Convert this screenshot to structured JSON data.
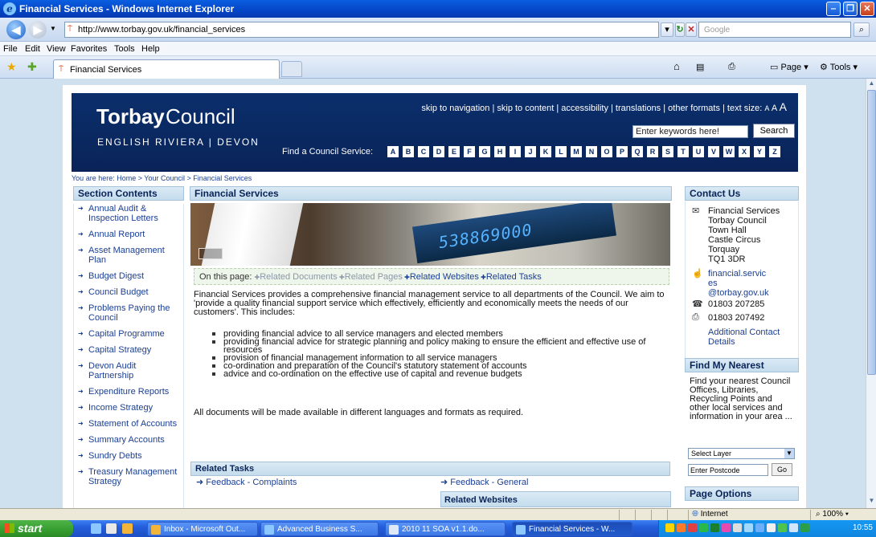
{
  "window": {
    "title": "Financial Services - Windows Internet Explorer",
    "minimize": "‒",
    "restore": "❐",
    "close": "✕"
  },
  "addressbar": {
    "url": "http://www.torbay.gov.uk/financial_services",
    "search_placeholder": "Google"
  },
  "menu": [
    "File",
    "Edit",
    "View",
    "Favorites",
    "Tools",
    "Help"
  ],
  "tab": {
    "label": "Financial Services"
  },
  "commandbar": {
    "page": "Page",
    "tools": "Tools"
  },
  "site": {
    "logo_main": "Torbay",
    "logo_sub": "Council",
    "tagline": "ENGLISH RIVIERA | DEVON",
    "toplinks": "skip to navigation | skip to content | accessibility | translations | other formats | text size:",
    "textsize_small": "A",
    "textsize_medium": "A",
    "textsize_large": "A",
    "search_value": "Enter keywords here!",
    "search_button": "Search",
    "find_service": "Find a Council Service:",
    "az": [
      "A",
      "B",
      "C",
      "D",
      "E",
      "F",
      "G",
      "H",
      "I",
      "J",
      "K",
      "L",
      "M",
      "N",
      "O",
      "P",
      "Q",
      "R",
      "S",
      "T",
      "U",
      "V",
      "W",
      "X",
      "Y",
      "Z"
    ],
    "breadcrumb": "You are here: Home > Your Council > Financial Services"
  },
  "section_contents": {
    "heading": "Section Contents",
    "items": [
      "Annual Audit & Inspection Letters",
      "Annual Report",
      "Asset Management Plan",
      "Budget Digest",
      "Council Budget",
      "Problems Paying the Council",
      "Capital Programme",
      "Capital Strategy",
      "Devon Audit Partnership",
      "Expenditure Reports",
      "Income Strategy",
      "Statement of Accounts",
      "Summary Accounts",
      "Sundry Debts",
      "Treasury Management Strategy"
    ]
  },
  "main": {
    "heading": "Financial Services",
    "hero_display": "538869000",
    "on_this_page_label": "On this page:",
    "on_this_page": [
      {
        "label": "Related Documents",
        "active": false
      },
      {
        "label": "Related Pages",
        "active": false
      },
      {
        "label": "Related Websites",
        "active": true
      },
      {
        "label": "Related Tasks",
        "active": true
      }
    ],
    "intro": "Financial Services provides a comprehensive financial management service to all departments of the Council. We aim to 'provide a quality financial support service which effectively, efficiently and economically meets the needs of our customers'. This includes:",
    "bullets": [
      "providing financial advice to all service managers and elected members",
      "providing financial advice for strategic planning and policy making to ensure the efficient and effective use of resources",
      "provision of financial management information to all service managers",
      "co-ordination and preparation of the Council's statutory statement of accounts",
      "advice and co-ordination on the effective use of capital and revenue budgets"
    ],
    "all_documents": "All documents will be made available in different languages and formats as required.",
    "related_tasks_heading": "Related Tasks",
    "related_tasks": [
      "Feedback - Complaints",
      "Feedback - General"
    ],
    "related_websites_heading": "Related Websites"
  },
  "contact": {
    "heading": "Contact Us",
    "address": [
      "Financial Services",
      "Torbay Council",
      "Town Hall",
      "Castle Circus",
      "Torquay",
      "TQ1 3DR"
    ],
    "email_lines": [
      "financial.servic",
      "es",
      "@torbay.gov.uk"
    ],
    "phone": "01803 207285",
    "fax": "01803 207492",
    "additional": [
      "Additional Contact",
      "Details"
    ]
  },
  "find_nearest": {
    "heading": "Find My Nearest",
    "text": "Find your nearest Council Offices, Libraries, Recycling Points and other local services and information in your area ...",
    "select_value": "Select Layer",
    "postcode_value": "Enter Postcode",
    "go": "Go"
  },
  "page_options": {
    "heading": "Page Options"
  },
  "statusbar": {
    "zone": "Internet",
    "zoom": "100%"
  },
  "taskbar": {
    "start": "start",
    "tasks": [
      {
        "label": "Inbox - Microsoft Out...",
        "active": false
      },
      {
        "label": "Advanced Business S...",
        "active": false
      },
      {
        "label": "2010 11 SOA v1.1.do...",
        "active": false
      },
      {
        "label": "Financial Services - W...",
        "active": true
      }
    ],
    "clock": "10:55"
  },
  "colors": {
    "banner": "#0a2860",
    "link": "#1b3f93",
    "box_head": "#c4dcec",
    "page_bg": "#cfe1ef"
  }
}
